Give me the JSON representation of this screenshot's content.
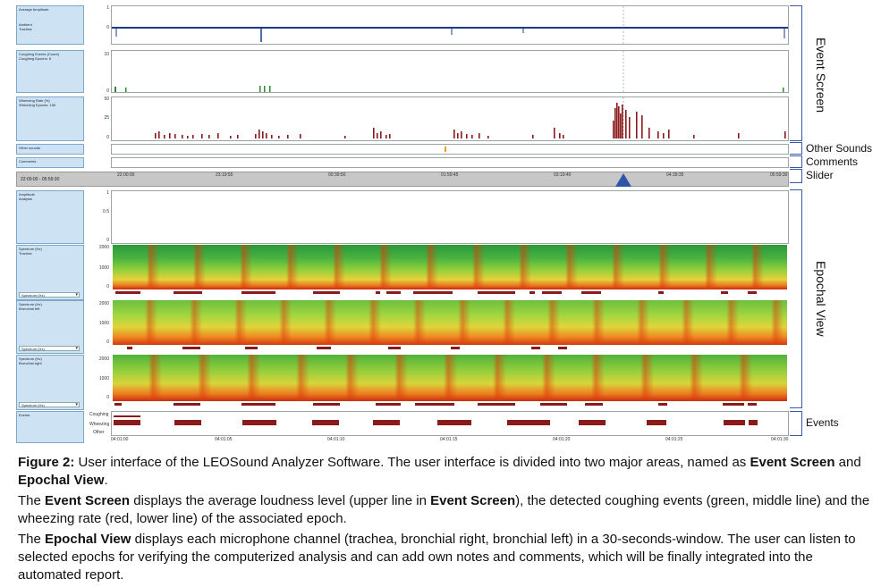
{
  "panels": {
    "avg_amplitude": {
      "label1": "Average Amplitude",
      "label2": "Ambient",
      "label3": "Trachea",
      "ticks": [
        "1",
        "0"
      ]
    },
    "coughing": {
      "label1": "Coughing Events (Count)",
      "label2": "Coughing Epochs: 8",
      "ticks": [
        "10",
        "0"
      ]
    },
    "wheezing": {
      "label1": "Wheezing Rate (%)",
      "label2": "Wheezing Epochs: 150",
      "ticks": [
        "50",
        "25",
        "0"
      ]
    },
    "other_sounds": {
      "label": "Other sounds"
    },
    "comments": {
      "label": "Comments"
    },
    "slider": {
      "range": "22:00:00 - 05:59:30",
      "times": [
        "22:00:00",
        "23:19:55",
        "00:39:50",
        "01:59:45",
        "03:19:40",
        "04:39:35",
        "05:59:30"
      ]
    },
    "amplitude_analysis": {
      "label1": "Amplitude",
      "label2": "Analysis",
      "ticks": [
        "1",
        "0.5",
        "0"
      ]
    },
    "spec_trachea": {
      "label1": "Spectrum (Hz)",
      "label2": "Trachea",
      "ticks": [
        "2000",
        "1000",
        "0"
      ],
      "dropdown": "Spectrum (Hz)"
    },
    "spec_br_left": {
      "label1": "Spectrum (Hz)",
      "label2": "Bronchial left",
      "ticks": [
        "2000",
        "1000",
        "0"
      ],
      "dropdown": "Spectrum (Hz)"
    },
    "spec_br_right": {
      "label1": "Spectrum (Hz)",
      "label2": "Bronchial right",
      "ticks": [
        "2000",
        "1000",
        "0"
      ],
      "dropdown": "Spectrum (Hz)"
    },
    "events": {
      "label": "Events",
      "rows": [
        "Coughing",
        "Wheezing",
        "Other"
      ],
      "times": [
        "04:01:00",
        "04:01:05",
        "04:01:10",
        "04:01:15",
        "04:01:20",
        "04:01:25",
        "04:01:30"
      ]
    }
  },
  "annotations": {
    "event_screen": "Event Screen",
    "other_sounds": "Other Sounds",
    "comments": "Comments",
    "slider": "Slider",
    "epochal_view": "Epochal View",
    "events": "Events"
  },
  "colors": {
    "panel_bg": "#cde3f3",
    "amplitude": "#1d3a8a",
    "cough": "#2f8a2f",
    "wheeze": "#8b1a1a",
    "slider_marker": "#2f55a8"
  },
  "caption": {
    "fig_label": "Figure 2:",
    "p1_a": " User interface of the LEOSound Analyzer Software. The user interface is divided into two major areas, named as ",
    "p1_b": "Event Screen",
    "p1_c": " and ",
    "p1_d": "Epochal View",
    "p1_e": ".",
    "p2_a": "The ",
    "p2_b": "Event Screen",
    "p2_c": " displays the average loudness level (upper line in ",
    "p2_d": "Event Screen",
    "p2_e": "), the detected coughing events (green, middle line) and the wheezing rate (red, lower line) of the associated epoch.",
    "p3_a": "The ",
    "p3_b": "Epochal View",
    "p3_c": " displays each microphone channel (trachea, bronchial right, bronchial left) in a 30-seconds-window. The user can listen to selected epochs for verifying the computerized analysis and can add own notes and comments, which will be finally integrated into the automated report."
  }
}
